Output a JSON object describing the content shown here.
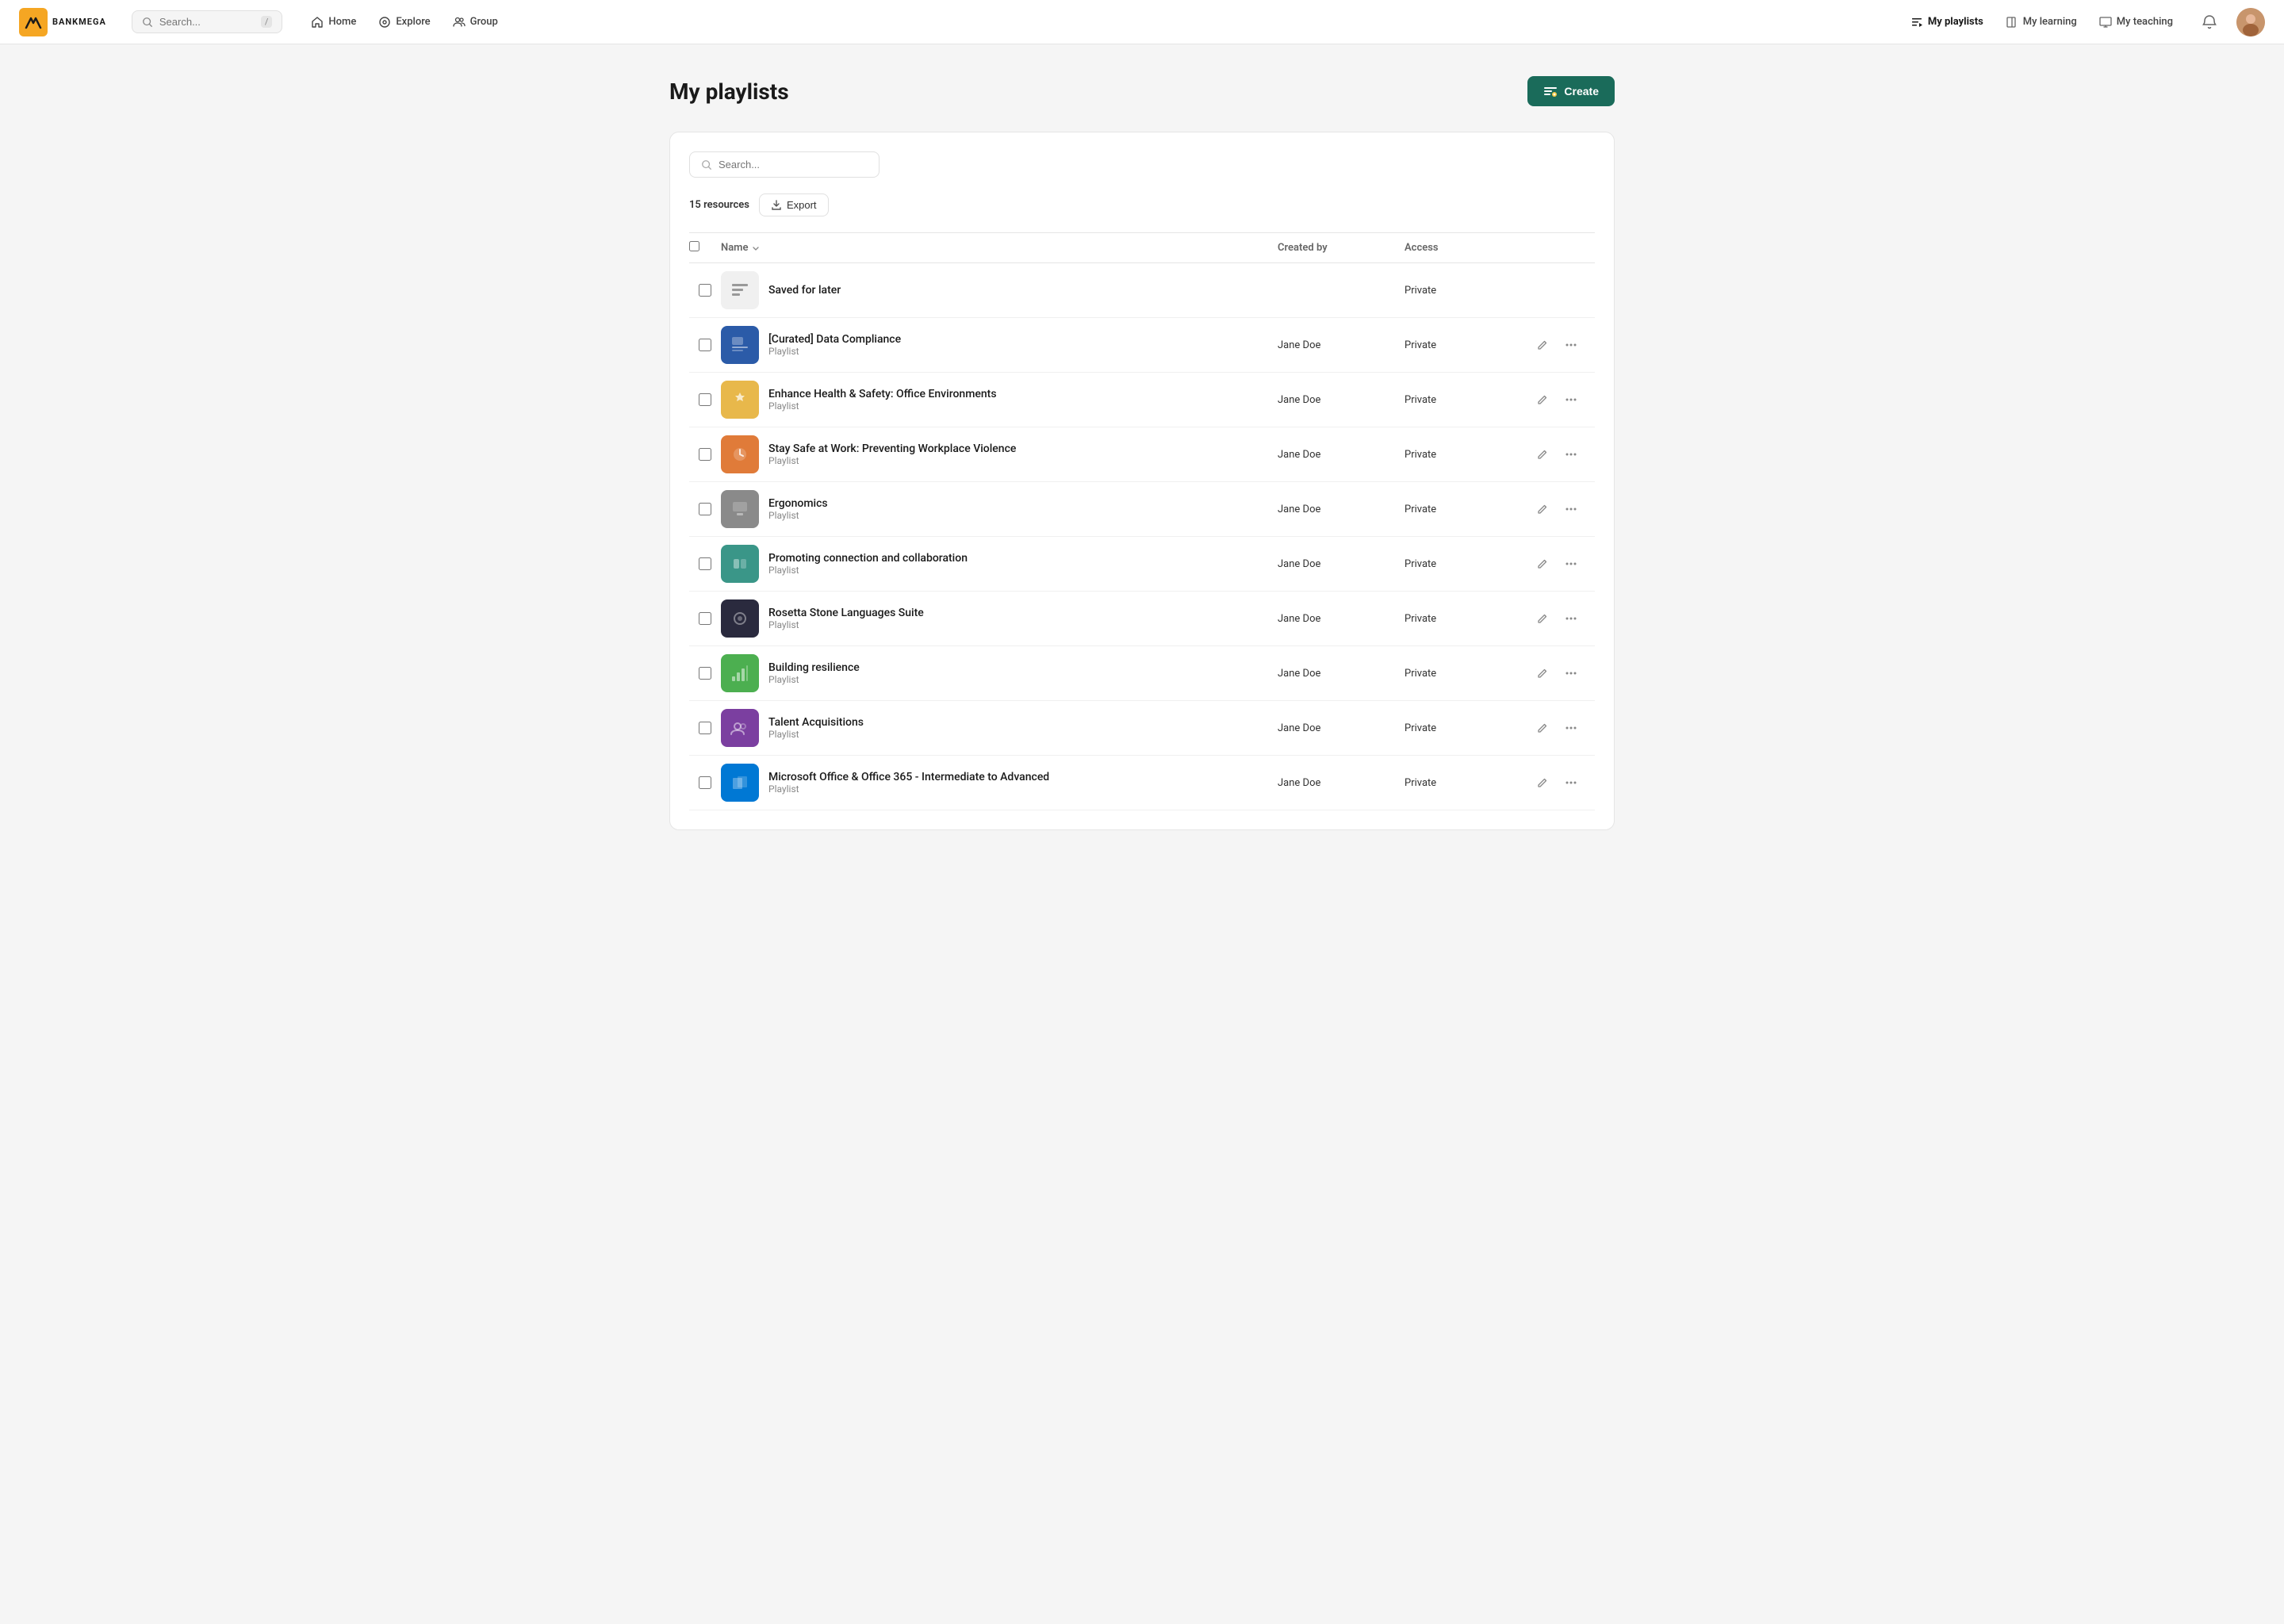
{
  "brand": {
    "logo_text": "M",
    "company": "BANKMEGA"
  },
  "navbar": {
    "search_placeholder": "Search...",
    "search_shortcut": "/",
    "nav_links": [
      {
        "id": "home",
        "label": "Home",
        "icon": "home-icon"
      },
      {
        "id": "explore",
        "label": "Explore",
        "icon": "explore-icon"
      },
      {
        "id": "group",
        "label": "Group",
        "icon": "group-icon"
      }
    ],
    "right_links": [
      {
        "id": "my-playlists",
        "label": "My playlists",
        "icon": "playlist-icon",
        "active": true
      },
      {
        "id": "my-learning",
        "label": "My learning",
        "icon": "book-icon",
        "active": false
      },
      {
        "id": "my-teaching",
        "label": "My teaching",
        "icon": "teach-icon",
        "active": false
      }
    ]
  },
  "page": {
    "title": "My playlists",
    "create_button": "Create",
    "resource_count": "15 resources",
    "export_button": "Export",
    "search_placeholder": "Search...",
    "table": {
      "columns": [
        "Name",
        "Created by",
        "Access"
      ],
      "rows": [
        {
          "id": "saved-for-later",
          "thumb_type": "saved",
          "thumb_content": "≡",
          "name": "Saved for later",
          "sub": "",
          "created_by": "",
          "access": "Private",
          "has_actions": false
        },
        {
          "id": "curated-data-compliance",
          "thumb_type": "blue",
          "thumb_content": "🖥",
          "name": "[Curated] Data Compliance",
          "sub": "Playlist",
          "created_by": "Jane Doe",
          "access": "Private",
          "has_actions": true
        },
        {
          "id": "enhance-health-safety",
          "thumb_type": "yellow",
          "thumb_content": "⚠",
          "name": "Enhance Health & Safety: Office Environments",
          "sub": "Playlist",
          "created_by": "Jane Doe",
          "access": "Private",
          "has_actions": true
        },
        {
          "id": "stay-safe-work",
          "thumb_type": "orange",
          "thumb_content": "⚠",
          "name": "Stay Safe at Work: Preventing Workplace Violence",
          "sub": "Playlist",
          "created_by": "Jane Doe",
          "access": "Private",
          "has_actions": true
        },
        {
          "id": "ergonomics",
          "thumb_type": "gray",
          "thumb_content": "🏢",
          "name": "Ergonomics",
          "sub": "Playlist",
          "created_by": "Jane Doe",
          "access": "Private",
          "has_actions": true
        },
        {
          "id": "promoting-connection",
          "thumb_type": "teal",
          "thumb_content": "📱",
          "name": "Promoting connection and collaboration",
          "sub": "Playlist",
          "created_by": "Jane Doe",
          "access": "Private",
          "has_actions": true
        },
        {
          "id": "rosetta-stone",
          "thumb_type": "dark",
          "thumb_content": "🌐",
          "name": "Rosetta Stone Languages Suite",
          "sub": "Playlist",
          "created_by": "Jane Doe",
          "access": "Private",
          "has_actions": true
        },
        {
          "id": "building-resilience",
          "thumb_type": "green",
          "thumb_content": "📊",
          "name": "Building resilience",
          "sub": "Playlist",
          "created_by": "Jane Doe",
          "access": "Private",
          "has_actions": true
        },
        {
          "id": "talent-acquisitions",
          "thumb_type": "purple",
          "thumb_content": "👥",
          "name": "Talent Acquisitions",
          "sub": "Playlist",
          "created_by": "Jane Doe",
          "access": "Private",
          "has_actions": true
        },
        {
          "id": "microsoft-office",
          "thumb_type": "officeblue",
          "thumb_content": "💻",
          "name": "Microsoft Office & Office 365 - Intermediate to Advanced",
          "sub": "Playlist",
          "created_by": "Jane Doe",
          "access": "Private",
          "has_actions": true
        }
      ]
    }
  }
}
